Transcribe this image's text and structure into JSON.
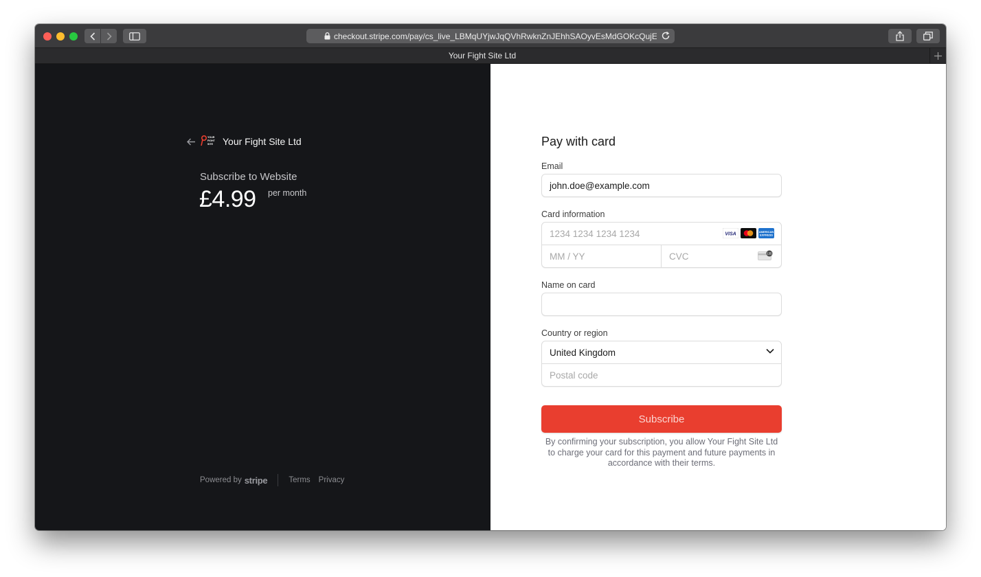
{
  "browser": {
    "url": "checkout.stripe.com/pay/cs_live_LBMqUYjwJqQVhRwknZnJEhhSAOyvEsMdGOKcQujENq",
    "tab_title": "Your Fight Site Ltd"
  },
  "merchant": {
    "name": "Your Fight Site Ltd",
    "logo_text": "YOUR FIGHT SITE"
  },
  "product": {
    "name": "Subscribe to Website",
    "price": "£4.99",
    "period": "per month"
  },
  "footer": {
    "powered_by": "Powered by",
    "brand": "stripe",
    "terms": "Terms",
    "privacy": "Privacy"
  },
  "form": {
    "title": "Pay with card",
    "email_label": "Email",
    "email_value": "john.doe@example.com",
    "card_label": "Card information",
    "card_number_placeholder": "1234 1234 1234 1234",
    "expiry_placeholder": "MM / YY",
    "cvc_placeholder": "CVC",
    "card_brands": [
      "VISA",
      "Mastercard",
      "American Express"
    ],
    "name_label": "Name on card",
    "name_value": "",
    "country_label": "Country or region",
    "country_value": "United Kingdom",
    "postal_placeholder": "Postal code",
    "submit_label": "Subscribe",
    "terms_text": "By confirming your subscription, you allow Your Fight Site Ltd to charge your card for this payment and future payments in accordance with their terms."
  },
  "colors": {
    "left_bg": "#151619",
    "accent": "#e93e2f",
    "toolbar": "#3b3b3d"
  }
}
